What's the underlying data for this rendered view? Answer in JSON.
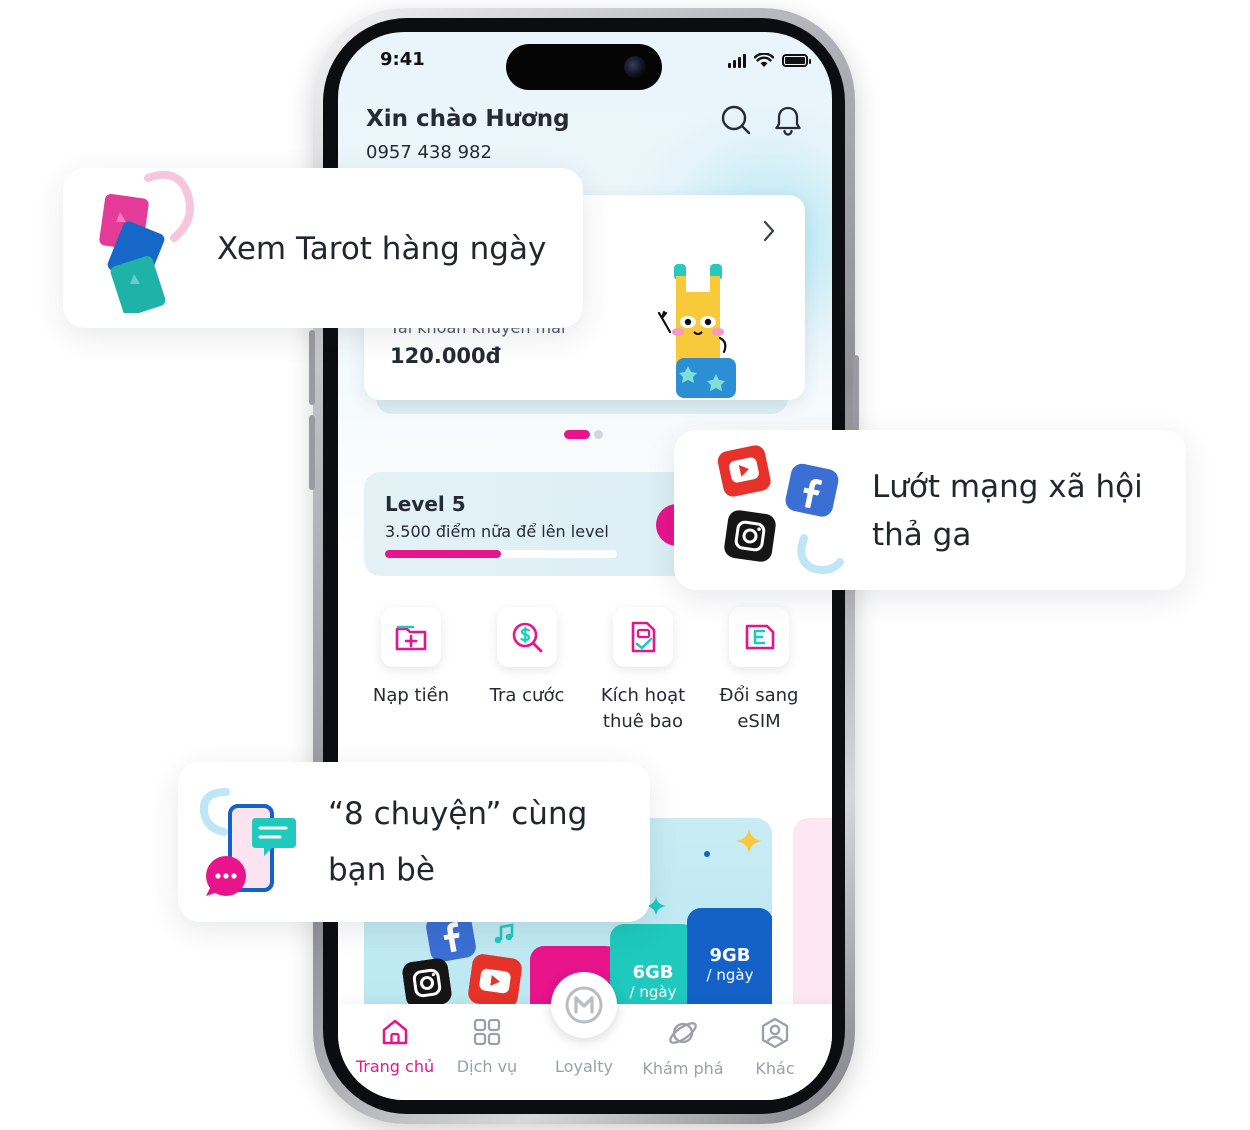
{
  "status_bar": {
    "time": "9:41"
  },
  "header": {
    "greeting": "Xin chào Hương",
    "phone_number": "0957 438 982"
  },
  "balance_card": {
    "promo_label": "Tài khoản khuyến mãi",
    "promo_value": "120.000đ"
  },
  "level": {
    "title": "Level 5",
    "subtitle": "3.500 điểm nữa để lên level",
    "progress": 0.5
  },
  "quick_actions": [
    {
      "label_line1": "Nạp tiền",
      "label_line2": "",
      "icon": "top-up-icon"
    },
    {
      "label_line1": "Tra cước",
      "label_line2": "",
      "icon": "bill-search-icon"
    },
    {
      "label_line1": "Kích hoạt",
      "label_line2": "thuê bao",
      "icon": "sim-activate-icon"
    },
    {
      "label_line1": "Đổi sang",
      "label_line2": "eSIM",
      "icon": "esim-icon"
    }
  ],
  "banner": {
    "plans": [
      {
        "amount": "6GB",
        "unit": "/ ngày"
      },
      {
        "amount": "9GB",
        "unit": "/ ngày"
      }
    ]
  },
  "bottom_nav": [
    {
      "label": "Trang chủ",
      "icon": "home-icon",
      "active": true
    },
    {
      "label": "Dịch vụ",
      "icon": "grid-icon",
      "active": false
    },
    {
      "label": "Loyalty",
      "icon": "loyalty-icon",
      "active": false
    },
    {
      "label": "Khám phá",
      "icon": "planet-icon",
      "active": false
    },
    {
      "label": "Khác",
      "icon": "profile-icon",
      "active": false
    }
  ],
  "callouts": {
    "tarot": "Xem Tarot hàng ngày",
    "social_line1": "Lướt mạng xã hội",
    "social_line2": "thả ga",
    "chat_line1": "“8 chuyện” cùng",
    "chat_line2": "bạn bè"
  },
  "colors": {
    "brand_pink": "#e8148c",
    "teal": "#1fc9bd",
    "blue": "#1461c7",
    "inactive_gray": "#9aa0a9"
  }
}
